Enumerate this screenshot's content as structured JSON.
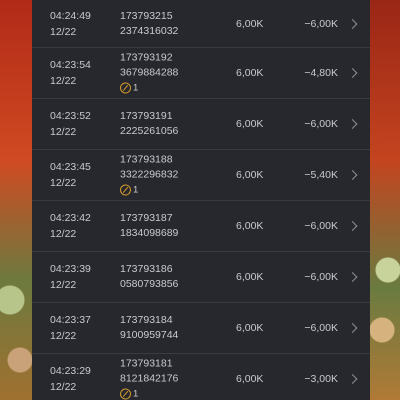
{
  "rows": [
    {
      "time": "04:24:49",
      "date": "12/22",
      "id1": "173793215",
      "id2": "2374316032",
      "badge": "",
      "bet": "6,00K",
      "win": "−6,00K"
    },
    {
      "time": "04:23:54",
      "date": "12/22",
      "id1": "173793192",
      "id2": "3679884288",
      "badge": "1",
      "bet": "6,00K",
      "win": "−4,80K"
    },
    {
      "time": "04:23:52",
      "date": "12/22",
      "id1": "173793191",
      "id2": "2225261056",
      "badge": "",
      "bet": "6,00K",
      "win": "−6,00K"
    },
    {
      "time": "04:23:45",
      "date": "12/22",
      "id1": "173793188",
      "id2": "3322296832",
      "badge": "1",
      "bet": "6,00K",
      "win": "−5,40K"
    },
    {
      "time": "04:23:42",
      "date": "12/22",
      "id1": "173793187",
      "id2": "1834098689",
      "badge": "",
      "bet": "6,00K",
      "win": "−6,00K"
    },
    {
      "time": "04:23:39",
      "date": "12/22",
      "id1": "173793186",
      "id2": "0580793856",
      "badge": "",
      "bet": "6,00K",
      "win": "−6,00K"
    },
    {
      "time": "04:23:37",
      "date": "12/22",
      "id1": "173793184",
      "id2": "9100959744",
      "badge": "",
      "bet": "6,00K",
      "win": "−6,00K"
    },
    {
      "time": "04:23:29",
      "date": "12/22",
      "id1": "173793181",
      "id2": "8121842176",
      "badge": "1",
      "bet": "6,00K",
      "win": "−3,00K"
    }
  ],
  "icons": {
    "badge": "pickaxe-icon",
    "row_action": "chevron-right-icon"
  }
}
